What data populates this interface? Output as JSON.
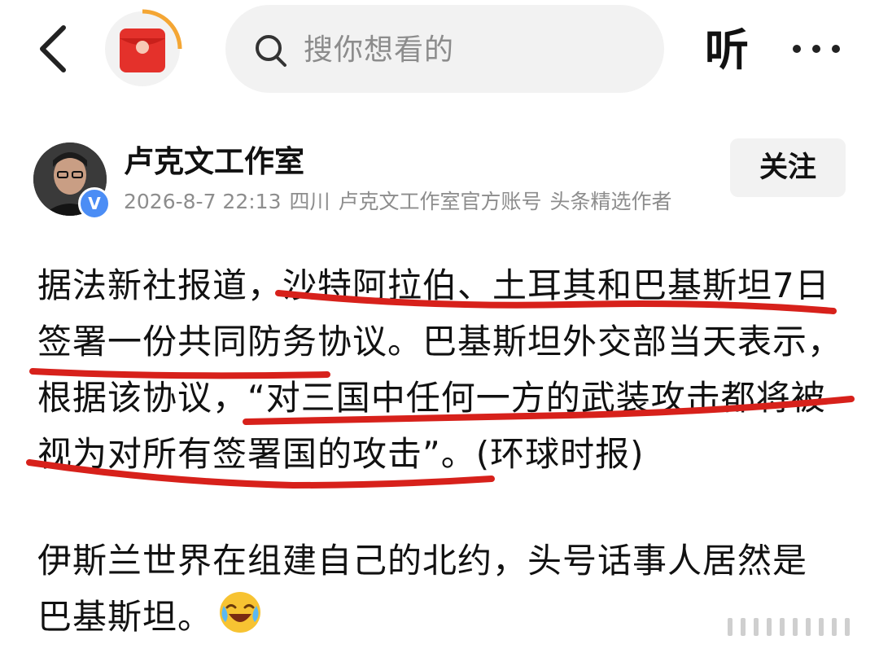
{
  "topbar": {
    "search_placeholder": "搜你想看的",
    "listen_label": "听",
    "icons": [
      "back-icon",
      "red-packet-icon",
      "search-icon",
      "more-icon"
    ]
  },
  "author": {
    "name": "卢克文工作室",
    "timestamp": "2026-8-7 22:13",
    "location": "四川",
    "account_desc": "卢克文工作室官方账号",
    "badge": "头条精选作者",
    "verified_mark": "V",
    "follow_label": "关注"
  },
  "article": {
    "para1_lines": [
      "据法新社报道，沙特阿拉伯、土耳其和巴基斯坦7日",
      "签署一份共同防务协议。巴基斯坦外交部当天表示，",
      "根据该协议，“对三国中任何一方的武装攻击都将被",
      "视为对所有签署国的攻击”。(环球时报)"
    ],
    "para2_lines": [
      "伊斯兰世界在组建自己的北约，头号话事人居然是",
      "巴基斯坦。"
    ],
    "emoji": "laughing-crying-emoji"
  },
  "colors": {
    "accent_red": "#e4312b",
    "annotation_red": "#d7211b",
    "verified_blue": "#4b8df5",
    "meta_gray": "#8d8d8d"
  }
}
